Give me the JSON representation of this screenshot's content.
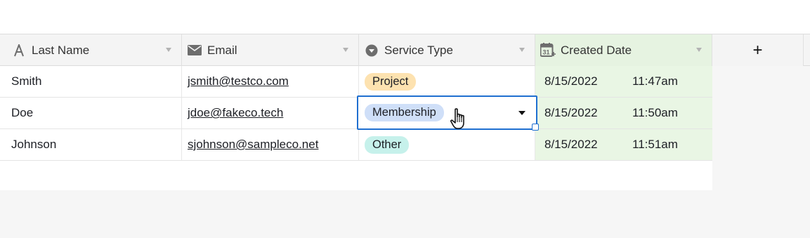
{
  "columns": [
    {
      "label": "Last Name",
      "icon": "text-field-icon"
    },
    {
      "label": "Email",
      "icon": "envelope-icon"
    },
    {
      "label": "Service Type",
      "icon": "single-select-icon"
    },
    {
      "label": "Created Date",
      "icon": "calendar-created-icon"
    }
  ],
  "add_column_label": "+",
  "rows": [
    {
      "last_name": "Smith",
      "email": "jsmith@testco.com",
      "service_type": "Project",
      "date": "8/15/2022",
      "time": "11:47am"
    },
    {
      "last_name": "Doe",
      "email": "jdoe@fakeco.tech",
      "service_type": "Membership",
      "date": "8/15/2022",
      "time": "11:50am"
    },
    {
      "last_name": "Johnson",
      "email": "sjohnson@sampleco.net",
      "service_type": "Other",
      "date": "8/15/2022",
      "time": "11:51am"
    }
  ],
  "colors": {
    "project_pill": "#fde2b0",
    "membership_pill": "#cfdff8",
    "other_pill": "#c6f1eb",
    "selection_border": "#1f6fd0",
    "created_column_bg": "#e9f6e4"
  },
  "active_cell": {
    "row": 1,
    "column": "Service Type",
    "dropdown_open": false
  }
}
